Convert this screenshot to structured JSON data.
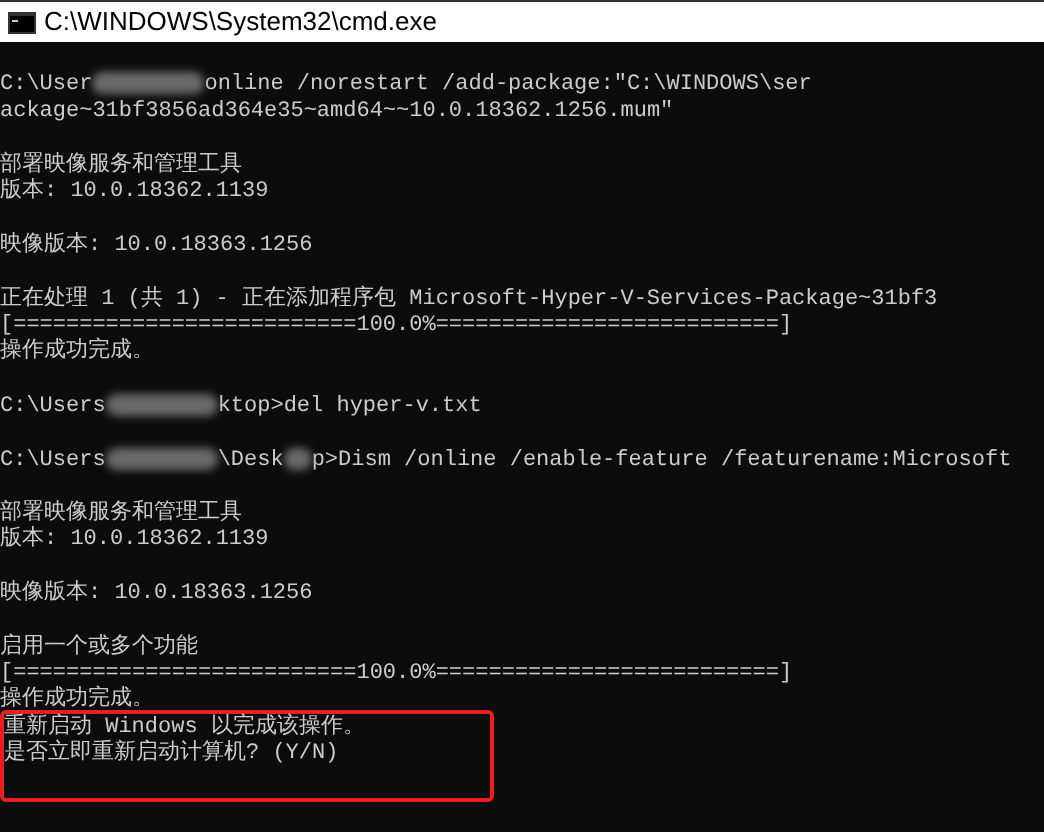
{
  "window": {
    "title": "C:\\WINDOWS\\System32\\cmd.exe"
  },
  "console": {
    "lines": [
      {
        "kind": "blank"
      },
      {
        "kind": "redacted",
        "parts": [
          {
            "kind": "text",
            "text": "C:\\User"
          },
          {
            "kind": "blur"
          },
          {
            "kind": "text",
            "text": "online /norestart /add-package:\"C:\\WINDOWS\\ser"
          }
        ]
      },
      {
        "kind": "text",
        "text": "ackage~31bf3856ad364e35~amd64~~10.0.18362.1256.mum\""
      },
      {
        "kind": "blank"
      },
      {
        "kind": "text",
        "text": "部署映像服务和管理工具"
      },
      {
        "kind": "text",
        "text": "版本: 10.0.18362.1139"
      },
      {
        "kind": "blank"
      },
      {
        "kind": "text",
        "text": "映像版本: 10.0.18363.1256"
      },
      {
        "kind": "blank"
      },
      {
        "kind": "text",
        "text": "正在处理 1 (共 1) - 正在添加程序包 Microsoft-Hyper-V-Services-Package~31bf3"
      },
      {
        "kind": "text",
        "text": "[==========================100.0%==========================]"
      },
      {
        "kind": "text",
        "text": "操作成功完成。"
      },
      {
        "kind": "blank"
      },
      {
        "kind": "redacted",
        "parts": [
          {
            "kind": "text",
            "text": "C:\\Users"
          },
          {
            "kind": "blur"
          },
          {
            "kind": "text",
            "text": "ktop>del hyper-v.txt"
          }
        ]
      },
      {
        "kind": "blank"
      },
      {
        "kind": "redacted",
        "parts": [
          {
            "kind": "text",
            "text": "C:\\Users"
          },
          {
            "kind": "blur"
          },
          {
            "kind": "text",
            "text": "\\Desk"
          },
          {
            "kind": "blot"
          },
          {
            "kind": "text",
            "text": "p>Dism /online /enable-feature /featurename:Microsoft"
          }
        ]
      },
      {
        "kind": "blank"
      },
      {
        "kind": "text",
        "text": "部署映像服务和管理工具"
      },
      {
        "kind": "text",
        "text": "版本: 10.0.18362.1139"
      },
      {
        "kind": "blank"
      },
      {
        "kind": "text",
        "text": "映像版本: 10.0.18363.1256"
      },
      {
        "kind": "blank"
      },
      {
        "kind": "text",
        "text": "启用一个或多个功能"
      },
      {
        "kind": "text",
        "text": "[==========================100.0%==========================]"
      },
      {
        "kind": "text",
        "text": "操作成功完成。"
      },
      {
        "kind": "text",
        "text": "重新启动 Windows 以完成该操作。",
        "highlighted": true
      },
      {
        "kind": "text",
        "text": "是否立即重新启动计算机? (Y/N)",
        "highlighted": true
      }
    ]
  }
}
